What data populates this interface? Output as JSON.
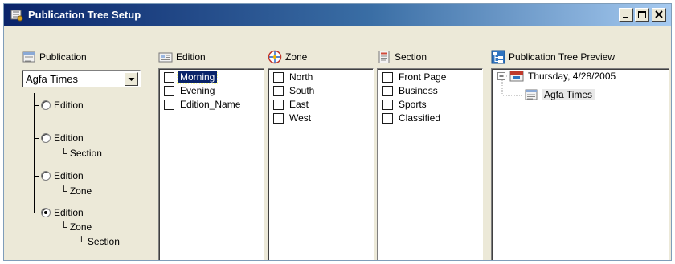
{
  "window": {
    "title": "Publication Tree Setup"
  },
  "publication": {
    "header": "Publication",
    "selected": "Agfa Times",
    "options": [
      {
        "label": "Edition",
        "sub": [],
        "checked": false
      },
      {
        "label": "Edition",
        "sub": [
          "Section"
        ],
        "checked": false
      },
      {
        "label": "Edition",
        "sub": [
          "Zone"
        ],
        "checked": false
      },
      {
        "label": "Edition",
        "sub": [
          "Zone",
          "Section"
        ],
        "checked": true
      }
    ]
  },
  "edition": {
    "header": "Edition",
    "items": [
      {
        "label": "Morning",
        "selected": true
      },
      {
        "label": "Evening",
        "selected": false
      },
      {
        "label": "Edition_Name",
        "selected": false
      }
    ]
  },
  "zone": {
    "header": "Zone",
    "items": [
      {
        "label": "North"
      },
      {
        "label": "South"
      },
      {
        "label": "East"
      },
      {
        "label": "West"
      }
    ]
  },
  "section": {
    "header": "Section",
    "items": [
      {
        "label": "Front Page"
      },
      {
        "label": "Business"
      },
      {
        "label": "Sports"
      },
      {
        "label": "Classified"
      }
    ]
  },
  "preview": {
    "header": "Publication Tree Preview",
    "date_node": "Thursday, 4/28/2005",
    "pub_node": "Agfa Times"
  },
  "icons": {
    "title": "setup-icon",
    "publication": "publication-icon",
    "edition": "edition-icon",
    "zone": "zone-icon",
    "section": "section-icon",
    "preview": "tree-icon"
  },
  "colors": {
    "titlebar_start": "#0a246a",
    "titlebar_end": "#a6caf0",
    "selection": "#0a246a",
    "window_bg": "#ece9d8"
  }
}
